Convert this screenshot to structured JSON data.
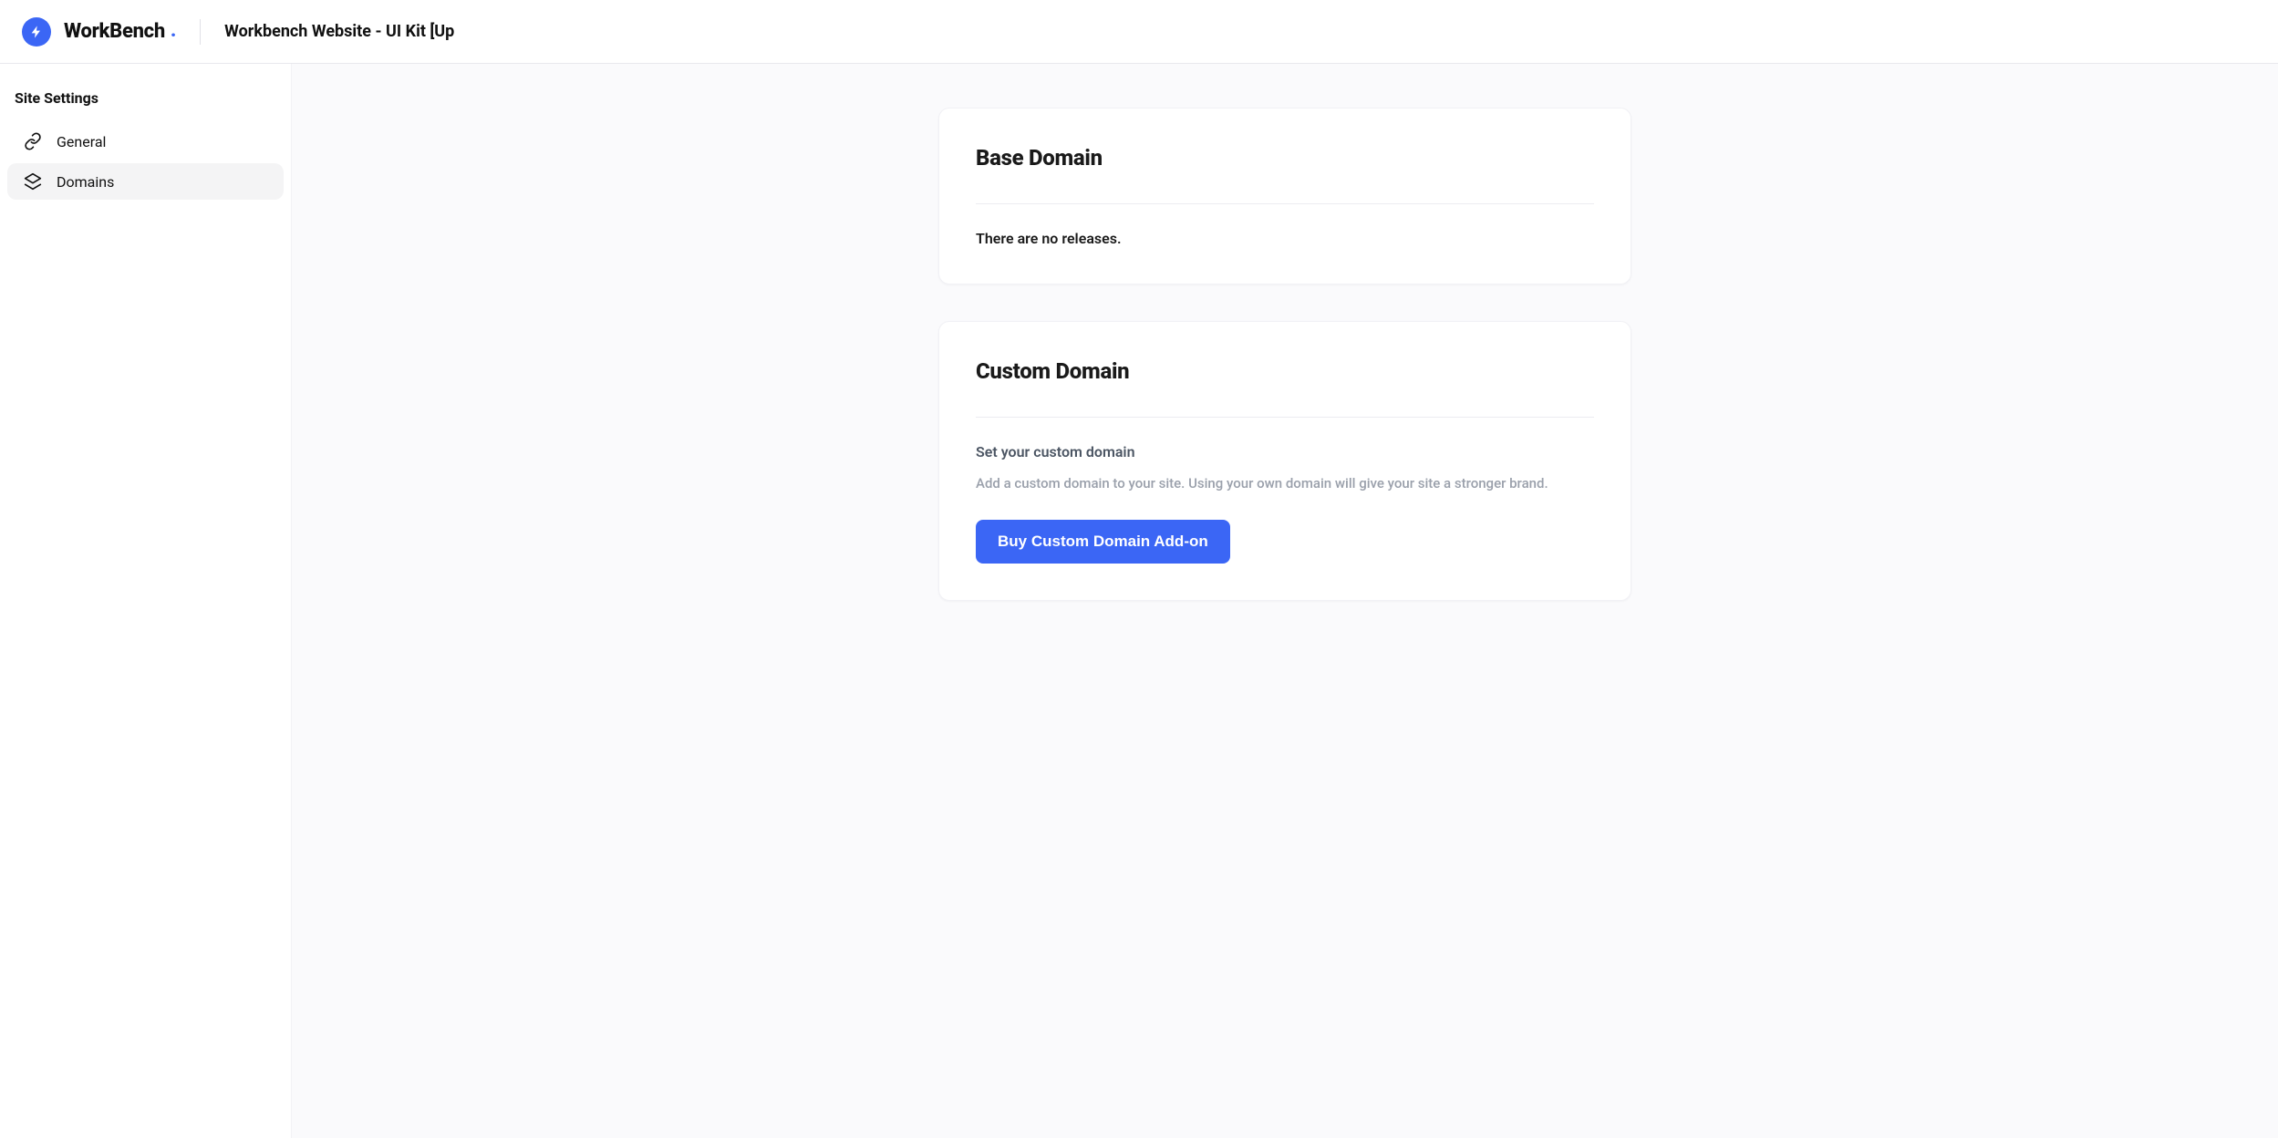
{
  "brand": {
    "name": "WorkBench",
    "dot": "."
  },
  "header": {
    "title": "Workbench Website - UI Kit [Up"
  },
  "sidebar": {
    "heading": "Site Settings",
    "items": [
      {
        "label": "General",
        "icon": "link-icon",
        "active": false
      },
      {
        "label": "Domains",
        "icon": "layers-icon",
        "active": true
      }
    ]
  },
  "cards": {
    "base": {
      "title": "Base Domain",
      "message": "There are no releases."
    },
    "custom": {
      "title": "Custom Domain",
      "subhead": "Set your custom domain",
      "description": "Add a custom domain to your site. Using your own domain will give your site a stronger brand.",
      "cta": "Buy Custom Domain Add-on"
    }
  }
}
